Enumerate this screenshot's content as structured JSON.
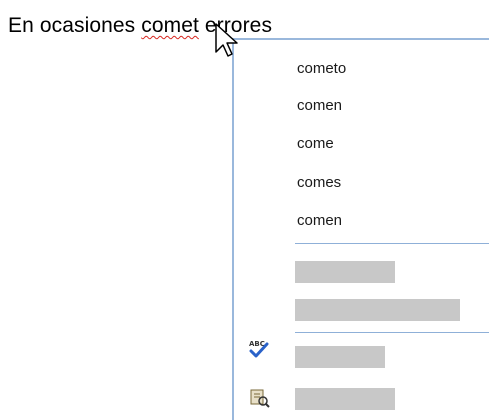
{
  "document": {
    "text_before": "En ocasiones ",
    "misspelled_word": "comet",
    "text_after": " errores"
  },
  "context_menu": {
    "suggestions": [
      {
        "label": "cometo"
      },
      {
        "label": "comen"
      },
      {
        "label": "come"
      },
      {
        "label": "comes"
      },
      {
        "label": "comen"
      }
    ],
    "placeholder_items": 4,
    "icons": [
      "spellcheck-abc-icon",
      "language-tools-icon"
    ]
  },
  "colors": {
    "menu_border": "#9ab8dc",
    "separator": "#8fb0d8",
    "placeholder": "#c8c8c8",
    "misspell_underline": "#d8261f"
  }
}
